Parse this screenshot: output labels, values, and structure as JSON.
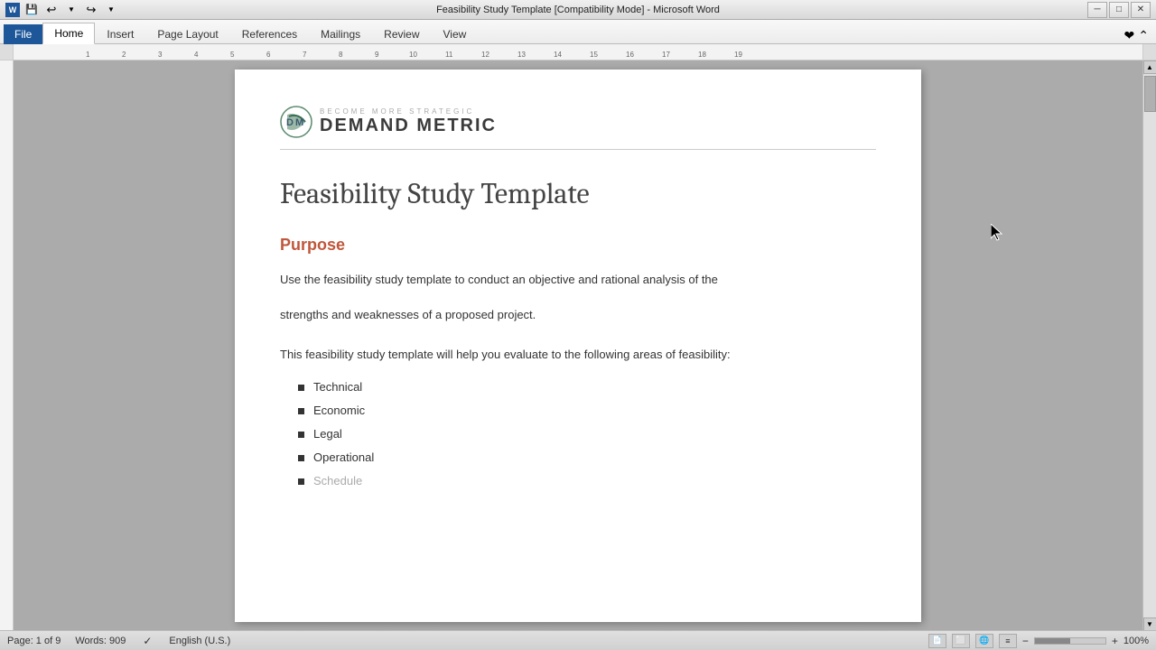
{
  "titlebar": {
    "title": "Feasibility Study Template [Compatibility Mode] - Microsoft Word",
    "minimize_label": "─",
    "maximize_label": "□",
    "close_label": "✕"
  },
  "quickaccess": {
    "save_label": "💾",
    "undo_label": "↩",
    "redo_label": "↪"
  },
  "ribbon": {
    "file_label": "File",
    "tabs": [
      {
        "label": "Home",
        "active": true
      },
      {
        "label": "Insert",
        "active": false
      },
      {
        "label": "Page Layout",
        "active": false
      },
      {
        "label": "References",
        "active": false
      },
      {
        "label": "Mailings",
        "active": false
      },
      {
        "label": "Review",
        "active": false
      },
      {
        "label": "View",
        "active": false
      }
    ]
  },
  "logo": {
    "tagline": "Become More Strategic",
    "name": "Demand Metric"
  },
  "document": {
    "title": "Feasibility Study Template",
    "section_purpose": "Purpose",
    "paragraph1": "Use the feasibility study template to conduct an objective and rational analysis of the",
    "paragraph1b": "strengths and weaknesses of a proposed project.",
    "paragraph2": "This feasibility study template will help you evaluate to the following areas of feasibility:",
    "bullet_items": [
      "Technical",
      "Economic",
      "Legal",
      "Operational",
      "Schedule"
    ]
  },
  "statusbar": {
    "page_info": "Page: 1 of 9",
    "word_count": "Words: 909",
    "language": "English (U.S.)",
    "zoom_level": "100%"
  }
}
